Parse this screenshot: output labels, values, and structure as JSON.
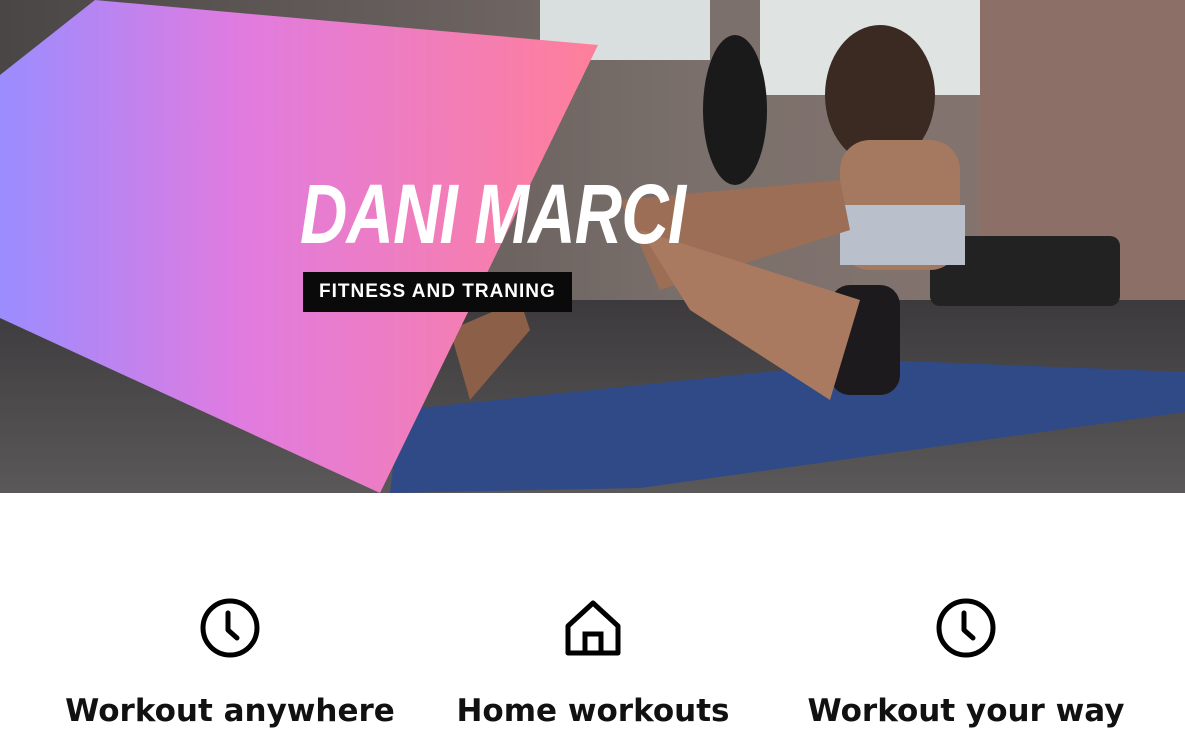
{
  "hero": {
    "title": "DANI MARCI",
    "tagline": "FITNESS AND TRANING",
    "gradient": {
      "from": "#9b8cff",
      "mid": "#e07be0",
      "to": "#ff7f9a"
    }
  },
  "features": [
    {
      "icon": "clock-icon",
      "title": "Workout anywhere"
    },
    {
      "icon": "home-icon",
      "title": "Home workouts"
    },
    {
      "icon": "clock-icon",
      "title": "Workout your way"
    }
  ]
}
